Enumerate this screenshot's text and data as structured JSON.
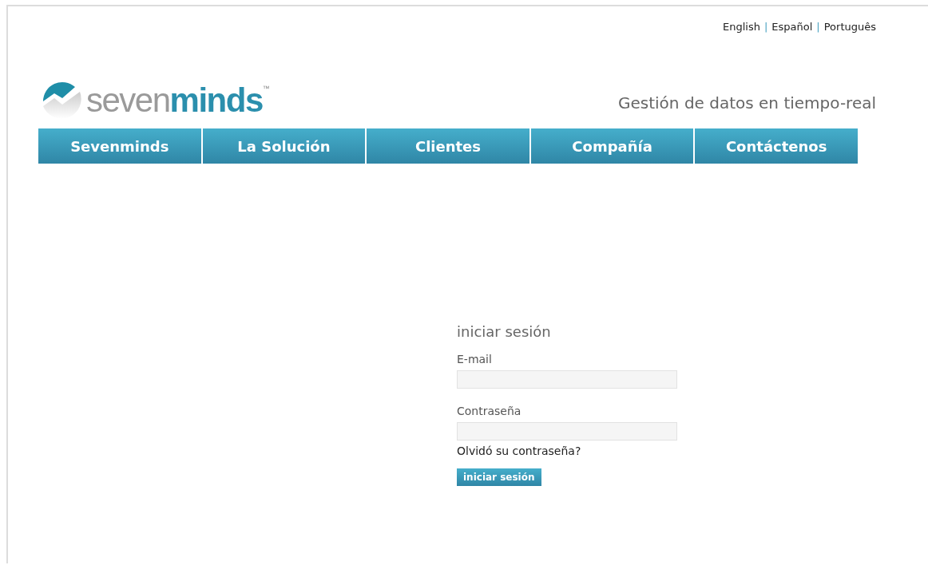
{
  "languages": [
    "English",
    "Español",
    "Português"
  ],
  "language_separator": "|",
  "logo": {
    "light": "seven",
    "bold": "minds",
    "trademark": "™"
  },
  "tagline": "Gestión de datos en tiempo-real",
  "nav": [
    "Sevenminds",
    "La Solución",
    "Clientes",
    "Compañía",
    "Contáctenos"
  ],
  "login": {
    "title": "iniciar sesión",
    "fields": [
      {
        "label": "E-mail"
      },
      {
        "label": "Contraseña"
      }
    ],
    "forgot": "Olvidó su contraseña?",
    "button": "iniciar sesión"
  }
}
